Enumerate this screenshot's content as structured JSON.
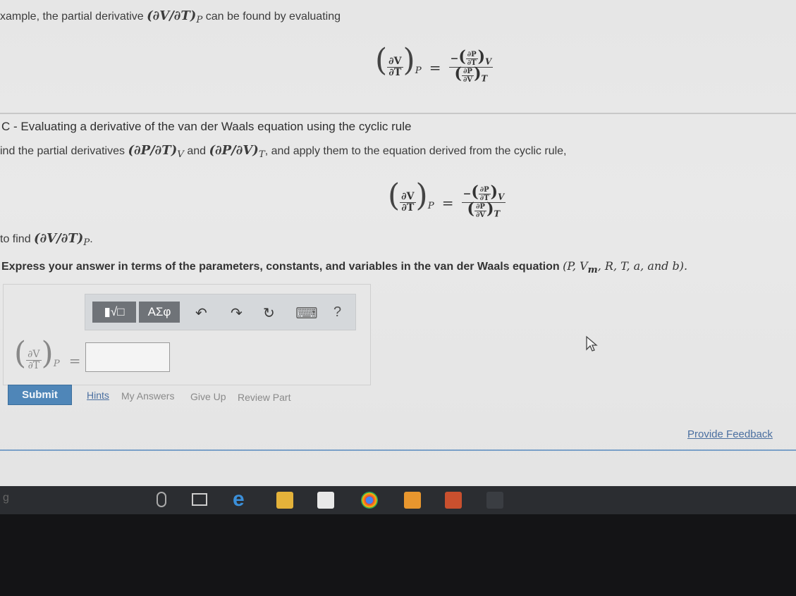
{
  "intro": {
    "text_start": "xample, the partial derivative",
    "derivative": "(∂V/∂T)",
    "derivative_sub": "P",
    "text_end": "can be found by evaluating"
  },
  "equation": {
    "lhs_num": "∂V",
    "lhs_den": "∂T",
    "lhs_sub": "P",
    "equals": "=",
    "rhs_num_sign": "−",
    "rhs_num_num": "∂P",
    "rhs_num_den": "∂T",
    "rhs_num_sub": "V",
    "rhs_den_num": "∂P",
    "rhs_den_den": "∂V",
    "rhs_den_sub": "T"
  },
  "section_c": {
    "title": "C - Evaluating a derivative of the van der Waals equation using the cyclic rule",
    "instruction_start": "ind the partial derivatives",
    "deriv1": "(∂P/∂T)",
    "deriv1_sub": "V",
    "and": "and",
    "deriv2": "(∂P/∂V)",
    "deriv2_sub": "T",
    "instruction_end": ", and apply them to the equation derived from the cyclic rule,",
    "to_find": "to find",
    "to_find_deriv": "(∂V/∂T)",
    "to_find_sub": "P",
    "express": "Express your answer in terms of the parameters, constants, and variables in the van der Waals equation",
    "express_vars": "(P, V",
    "express_vars_sub": "m",
    "express_vars_end": ", R, T, a, and b)."
  },
  "toolbar": {
    "templates_icon": "templates-icon",
    "greek_label": "ΑΣφ",
    "undo": "↶",
    "redo": "↷",
    "reset": "↻",
    "keyboard": "⌨",
    "help": "?"
  },
  "answer": {
    "lhs_num": "∂V",
    "lhs_den": "∂T",
    "lhs_sub": "P",
    "equals": "=",
    "value": ""
  },
  "actions": {
    "submit": "Submit",
    "hints": "Hints",
    "my_answers": "My Answers",
    "give_up": "Give Up",
    "review_part": "Review Part",
    "feedback": "Provide Feedback"
  },
  "taskbar": {
    "search_hint": "g"
  }
}
